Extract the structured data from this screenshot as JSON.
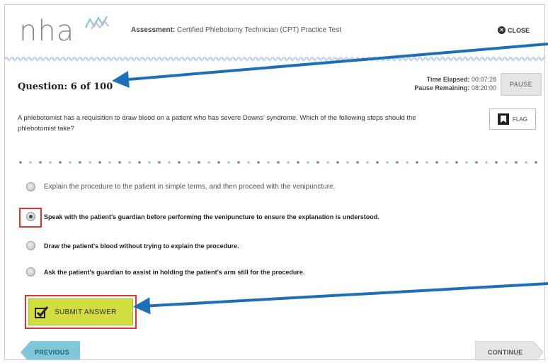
{
  "header": {
    "logo": "nha",
    "assessment_label": "Assessment:",
    "assessment_title": "Certified Phlebotomy Technician (CPT) Practice Test",
    "close_label": "CLOSE"
  },
  "question_bar": {
    "question_number": "Question: 6 of 100",
    "time_elapsed_label": "Time Elapsed:",
    "time_elapsed": "00:07:28",
    "pause_remaining_label": "Pause Remaining:",
    "pause_remaining": "08:20:00",
    "pause_label": "PAUSE"
  },
  "question": {
    "text": "A phlebotomist has a requisition to draw blood on a patient who has severe Downs' syndrome. Which of the following steps should the phlebotomist take?",
    "flag_label": "FLAG"
  },
  "options": [
    {
      "text": "Explain the procedure to the patient in simple terms, and then proceed with the venipuncture.",
      "selected": false
    },
    {
      "text": "Speak with the patient's guardian before performing the venipuncture to ensure the explanation is understood.",
      "selected": true
    },
    {
      "text": "Draw the patient's blood without trying to explain the procedure.",
      "selected": false
    },
    {
      "text": "Ask the patient's guardian to assist in holding the patient's arm still for the procedure.",
      "selected": false
    }
  ],
  "actions": {
    "submit_label": "SUBMIT ANSWER",
    "previous_label": "PREVIOUS",
    "continue_label": "CONTINUE"
  },
  "colors": {
    "submit_bg": "#d2de3f",
    "previous_bg": "#7fc7d9",
    "continue_bg": "#e6e6e6",
    "highlight_red": "#e0342f",
    "callout_arrow": "#1f6fb7"
  }
}
